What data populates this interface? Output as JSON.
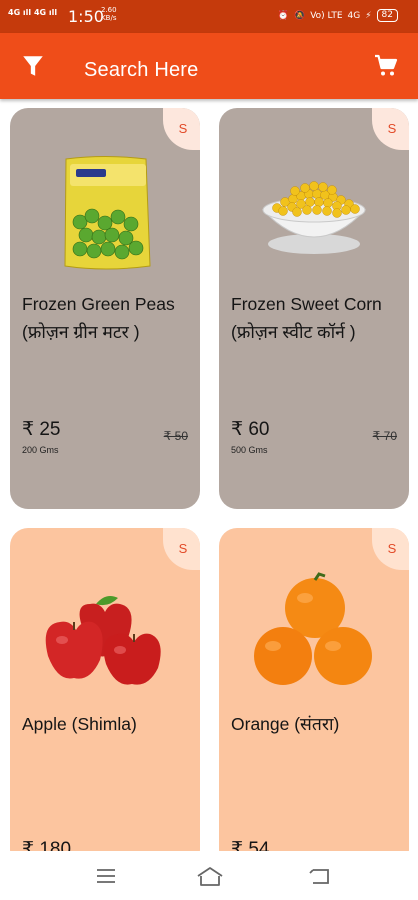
{
  "status_bar": {
    "signal_1": "4G",
    "signal_2": "4G",
    "time": "1:50",
    "net_speed": "2.60",
    "net_unit": "KB/s",
    "volte": "Vo) LTE",
    "lte_sig": "4G",
    "battery": "82"
  },
  "header": {
    "search_label": "Search Here",
    "icons": [
      "filter-icon",
      "cart-icon"
    ]
  },
  "products": [
    {
      "name": "Frozen Green Peas",
      "name_hindi": "(फ्रोज़न ग्रीन मटर )",
      "price": "₹ 25",
      "qty": "200 Gms",
      "mrp": "₹ 50",
      "badge": "S"
    },
    {
      "name": "Frozen Sweet Corn",
      "name_hindi": "(फ्रोज़न स्वीट कॉर्न )",
      "price": "₹ 60",
      "qty": "500 Gms",
      "mrp": "₹ 70",
      "badge": "S"
    },
    {
      "name": "Apple (Shimla)",
      "price": "₹ 180",
      "badge": "S"
    },
    {
      "name": "Orange (संतरा)",
      "price": "₹ 54",
      "badge": "S"
    }
  ],
  "colors": {
    "status_bar": "#c53a0c",
    "app_bar": "#ef4d19",
    "card_frozen": "#b3a7a0",
    "card_fruit": "#fcc59f",
    "badge_text": "#e24a28"
  },
  "nav": {
    "icons": [
      "menu-icon",
      "home-icon",
      "back-icon"
    ]
  }
}
